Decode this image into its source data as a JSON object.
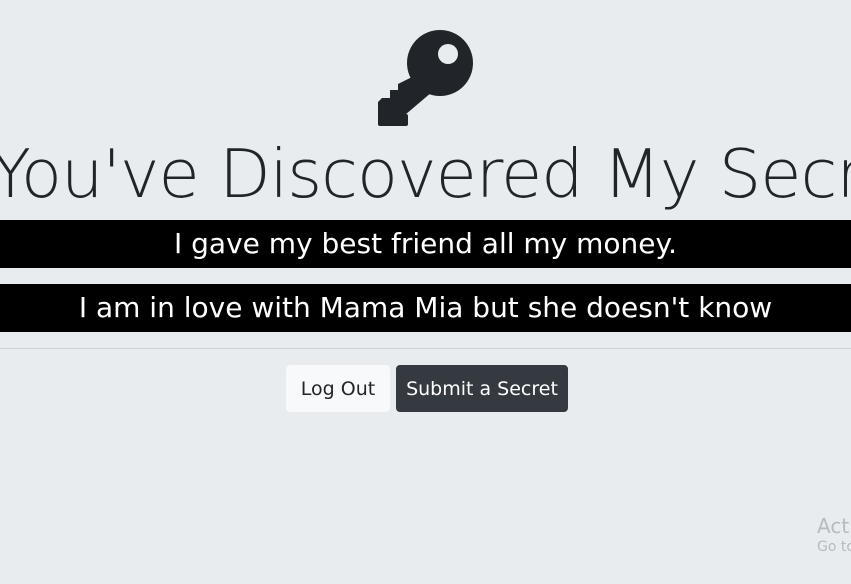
{
  "header": {
    "icon": "key-icon",
    "title": "You've Discovered My Secret!"
  },
  "secrets": [
    {
      "text": "I gave my best friend all my money."
    },
    {
      "text": "I am in love with Mama Mia but she doesn't know"
    }
  ],
  "actions": {
    "logout_label": "Log Out",
    "submit_label": "Submit a Secret"
  },
  "watermark": {
    "title": "Activate Windows",
    "subtitle": "Go to Settings to activate Windows."
  },
  "colors": {
    "background": "#e9ecef",
    "secret_bar": "#000000",
    "button_light": "#f8f9fa",
    "button_dark": "#343a40",
    "text": "#212529"
  }
}
